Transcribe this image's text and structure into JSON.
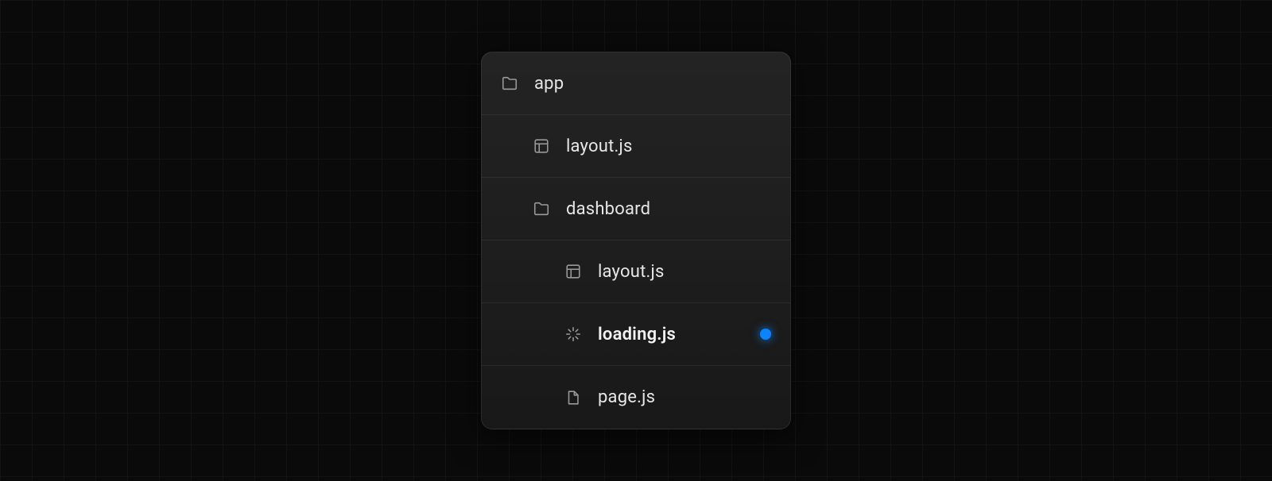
{
  "tree": {
    "items": [
      {
        "label": "app",
        "icon": "folder",
        "depth": 0,
        "highlight": false,
        "marker": false
      },
      {
        "label": "layout.js",
        "icon": "layout",
        "depth": 1,
        "highlight": false,
        "marker": false
      },
      {
        "label": "dashboard",
        "icon": "folder",
        "depth": 1,
        "highlight": false,
        "marker": false
      },
      {
        "label": "layout.js",
        "icon": "layout",
        "depth": 2,
        "highlight": false,
        "marker": false
      },
      {
        "label": "loading.js",
        "icon": "spinner",
        "depth": 2,
        "highlight": true,
        "marker": true
      },
      {
        "label": "page.js",
        "icon": "file",
        "depth": 2,
        "highlight": false,
        "marker": false
      }
    ]
  },
  "colors": {
    "accent": "#0a84ff",
    "panel_bg_top": "#262626",
    "panel_bg_bottom": "#1a1a1a",
    "canvas_bg": "#0a0a0a"
  }
}
